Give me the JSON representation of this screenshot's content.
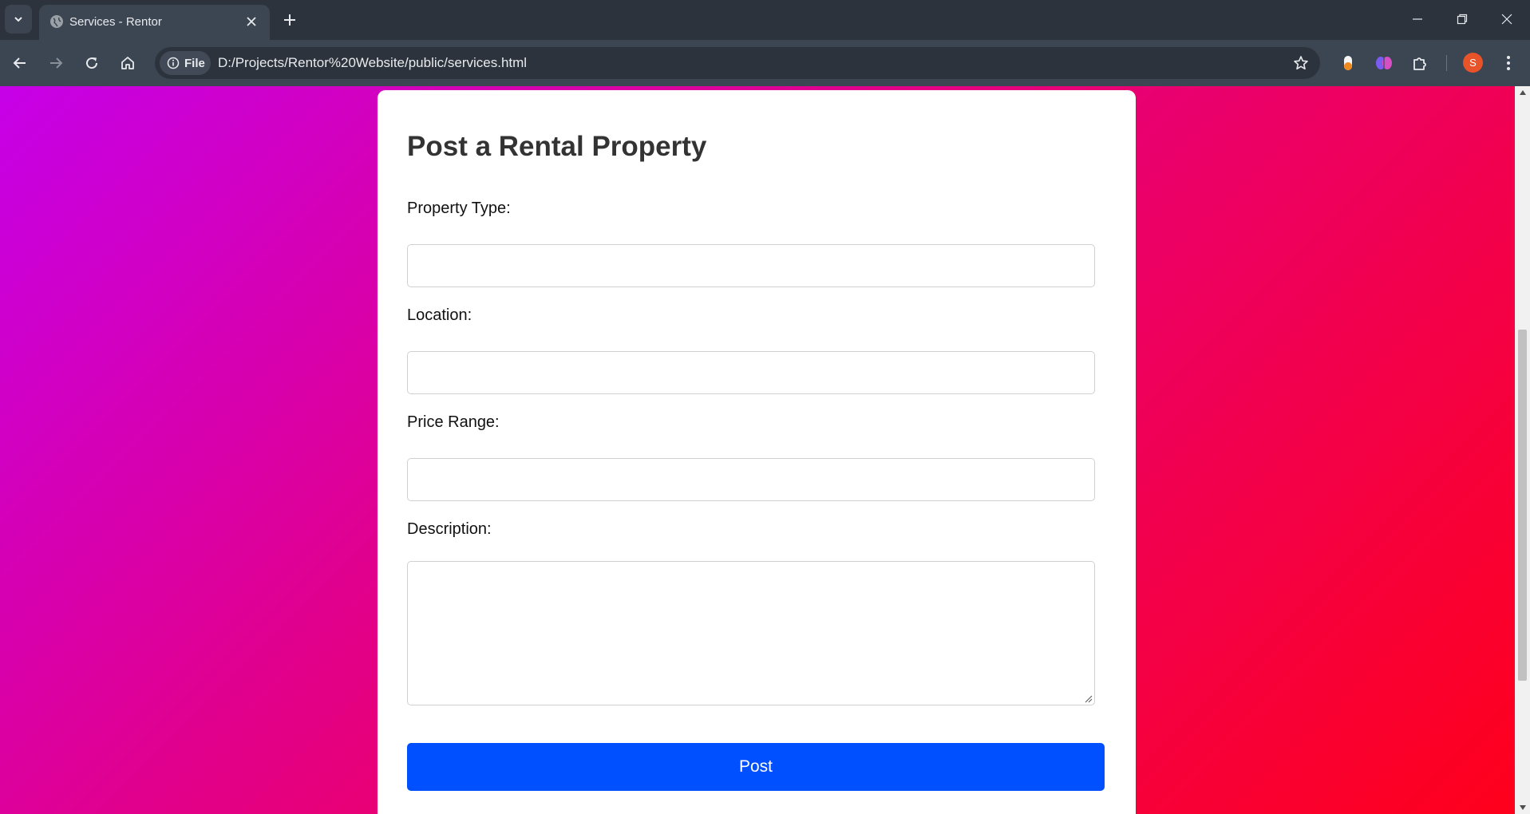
{
  "browser": {
    "tab_title": "Services - Rentor",
    "site_chip": "File",
    "url": "D:/Projects/Rentor%20Website/public/services.html",
    "profile_initial": "S",
    "colors": {
      "profile": "#e8532a",
      "chrome_dark": "#2c333d",
      "chrome_light": "#3c4653"
    }
  },
  "page": {
    "gradient": [
      "#c600e8",
      "#e6007c",
      "#ff001a"
    ],
    "form": {
      "title": "Post a Rental Property",
      "property_type_label": "Property Type:",
      "property_type_value": "",
      "location_label": "Location:",
      "location_value": "",
      "price_range_label": "Price Range:",
      "price_range_value": "",
      "description_label": "Description:",
      "description_value": "",
      "submit_label": "Post",
      "submit_color": "#0050ff"
    }
  },
  "icons": {
    "tab_list": "chevron-down-icon",
    "favicon": "globe-icon",
    "tab_close": "close-icon",
    "new_tab": "plus-icon",
    "back": "arrow-left-icon",
    "forward": "arrow-right-icon",
    "reload": "reload-icon",
    "home": "home-icon",
    "info": "info-icon",
    "bookmark": "star-icon",
    "extensions": [
      "extension-pill-icon",
      "extension-brain-icon",
      "puzzle-icon"
    ],
    "menu": "kebab-menu-icon"
  }
}
